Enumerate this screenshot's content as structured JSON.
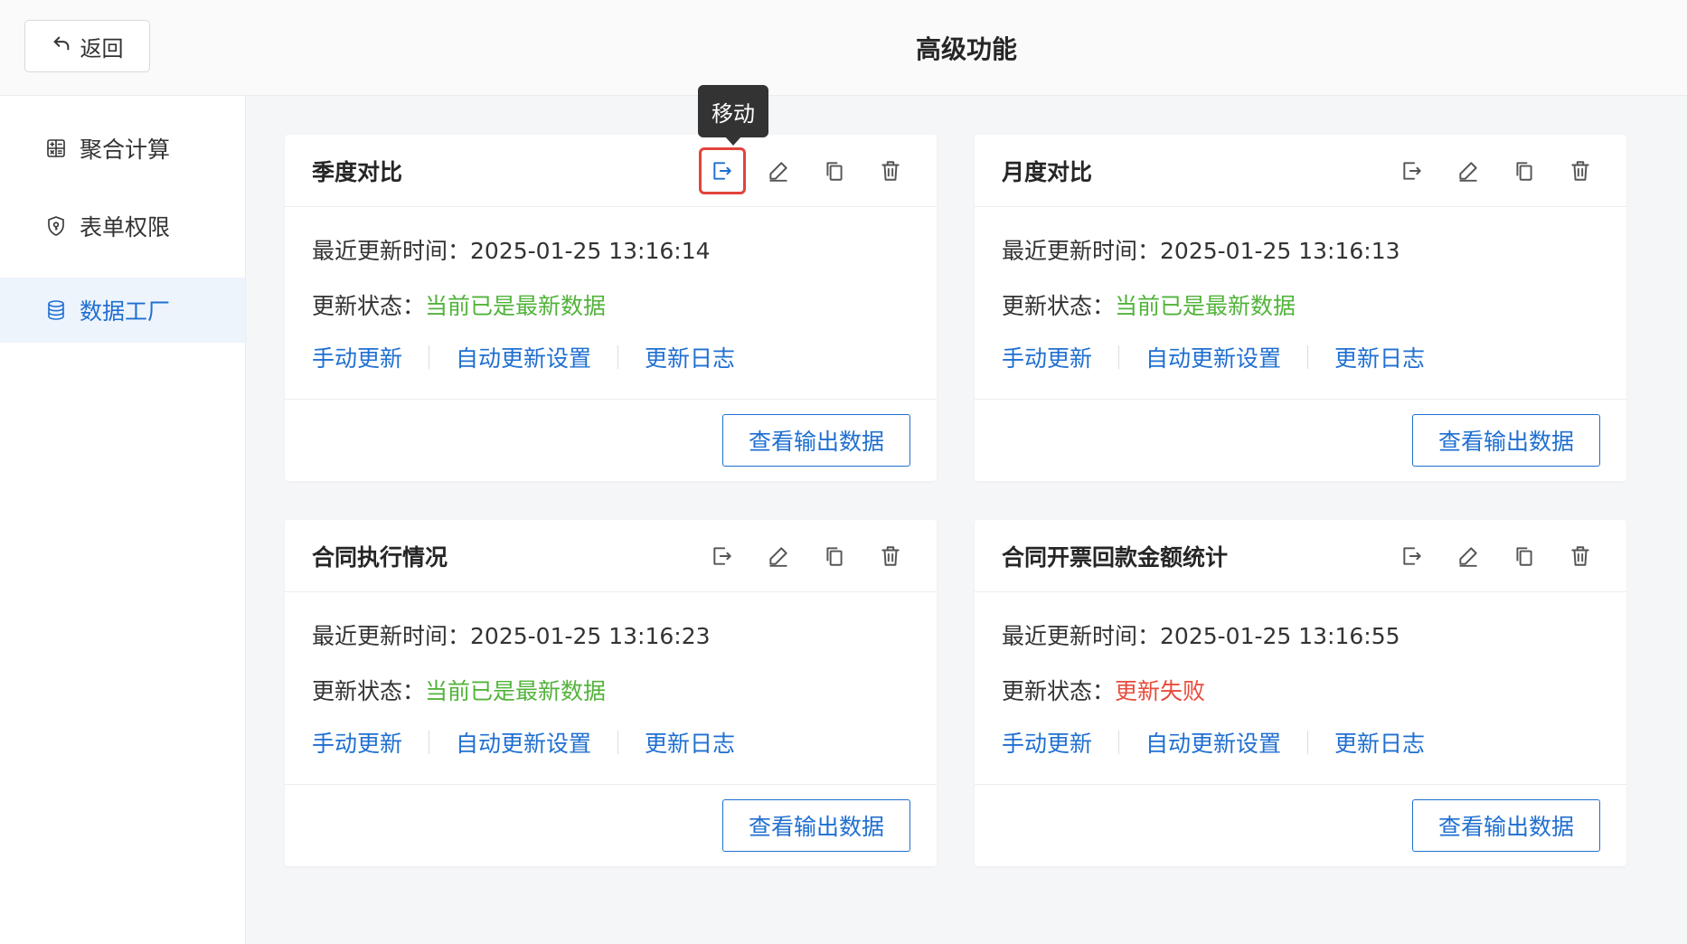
{
  "header": {
    "back_label": "返回",
    "title": "高级功能"
  },
  "sidebar": {
    "items": [
      {
        "label": "聚合计算",
        "icon": "calculator-icon"
      },
      {
        "label": "表单权限",
        "icon": "shield-icon"
      },
      {
        "label": "数据工厂",
        "icon": "database-icon",
        "active": true
      }
    ]
  },
  "tooltip": {
    "text": "移动"
  },
  "labels": {
    "update_time_prefix": "最近更新时间：",
    "status_prefix": "更新状态：",
    "manual_update": "手动更新",
    "auto_update_settings": "自动更新设置",
    "update_log": "更新日志",
    "view_output": "查看输出数据"
  },
  "cards": [
    {
      "title": "季度对比",
      "update_time": "2025-01-25 13:16:14",
      "status": "当前已是最新数据",
      "status_color": "#52b33b"
    },
    {
      "title": "月度对比",
      "update_time": "2025-01-25 13:16:13",
      "status": "当前已是最新数据",
      "status_color": "#52b33b"
    },
    {
      "title": "合同执行情况",
      "update_time": "2025-01-25 13:16:23",
      "status": "当前已是最新数据",
      "status_color": "#52b33b"
    },
    {
      "title": "合同开票回款金额统计",
      "update_time": "2025-01-25 13:16:55",
      "status": "更新失败",
      "status_color": "#e74c3c"
    }
  ],
  "colors": {
    "accent": "#1f6fd1",
    "success": "#52b33b",
    "error": "#e74c3c",
    "highlight_border": "#e0443c"
  }
}
